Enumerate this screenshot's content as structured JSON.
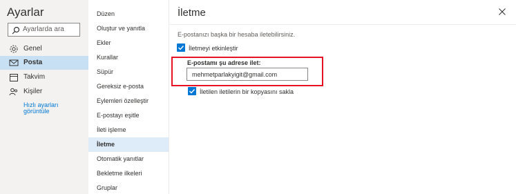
{
  "sidebar": {
    "title": "Ayarlar",
    "search_placeholder": "Ayarlarda ara",
    "items": [
      {
        "label": "Genel"
      },
      {
        "label": "Posta"
      },
      {
        "label": "Takvim"
      },
      {
        "label": "Kişiler"
      }
    ],
    "quick_link_line1": "Hızlı ayarları",
    "quick_link_line2": "görüntüle"
  },
  "submenu": {
    "items": [
      {
        "label": "Düzen"
      },
      {
        "label": "Oluştur ve yanıtla"
      },
      {
        "label": "Ekler"
      },
      {
        "label": "Kurallar"
      },
      {
        "label": "Süpür"
      },
      {
        "label": "Gereksiz e-posta"
      },
      {
        "label": "Eylemleri özelleştir"
      },
      {
        "label": "E-postayı eşitle"
      },
      {
        "label": "İleti işleme"
      },
      {
        "label": "İletme"
      },
      {
        "label": "Otomatik yanıtlar"
      },
      {
        "label": "Bekletme ilkeleri"
      },
      {
        "label": "Gruplar"
      }
    ],
    "selected": "İletme"
  },
  "main": {
    "title": "İletme",
    "description": "E-postanızı başka bir hesaba iletebilirsiniz.",
    "enable_forwarding_label": "İletmeyi etkinleştir",
    "enable_forwarding_checked": true,
    "forward_to_label": "E-postamı şu adrese ilet:",
    "forward_to_value": "mehmetparlakyigit@gmail.com",
    "keep_copy_label": "İletilen iletilerin bir kopyasını sakla",
    "keep_copy_checked": true
  },
  "colors": {
    "accent": "#0078d4",
    "highlight_box": "#e81123",
    "sidebar_bg": "#f3f2f1",
    "active_nav_bg": "#c7e0f4",
    "active_submenu_bg": "#deecf9"
  }
}
